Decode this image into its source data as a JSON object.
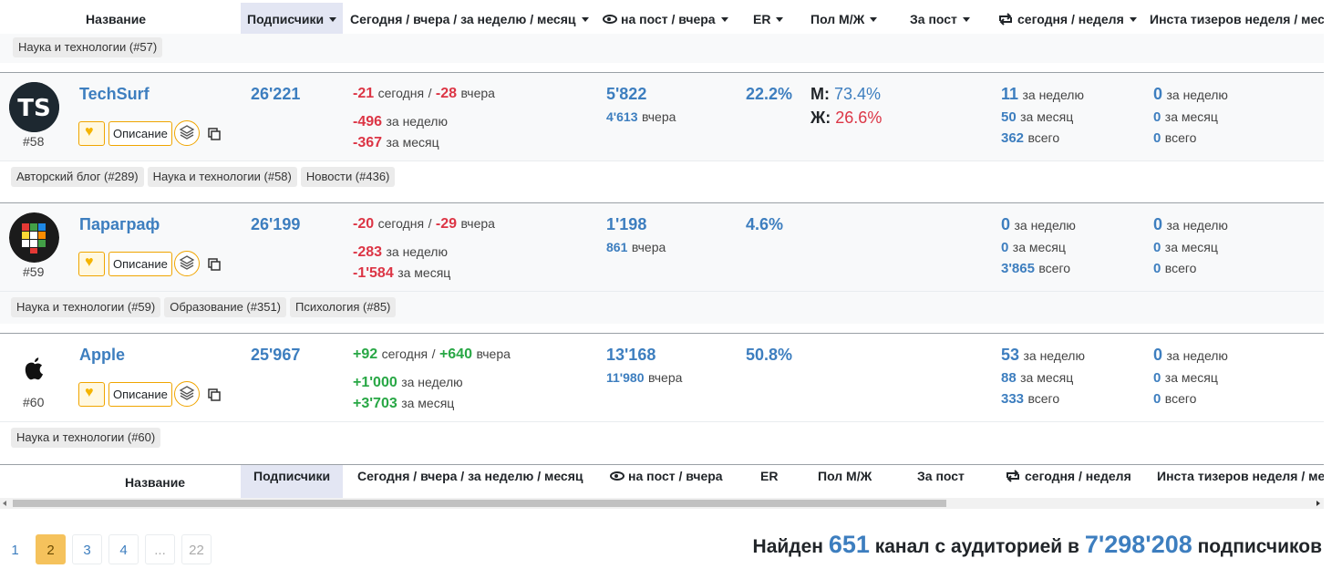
{
  "header": {
    "name": "Название",
    "subscribers": "Подписчики",
    "growth": "Сегодня / вчера / за неделю / месяц",
    "views": "на пост / вчера",
    "er": "ER",
    "gender": "Пол М/Ж",
    "per_post": "За пост",
    "reposts": "сегодня / неделя",
    "insta": "Инста тизеров неделя / месяц"
  },
  "prev_tag": "Наука и технологии (#57)",
  "labels": {
    "today": "сегодня",
    "yesterday": "вчера",
    "week": "за неделю",
    "month": "за месяц",
    "total": "всего",
    "slash": "/",
    "description": "Описание",
    "male": "М:",
    "female": "Ж:"
  },
  "rows": [
    {
      "name": "TechSurf",
      "rank": "#58",
      "subscribers": "26'221",
      "today": "-21",
      "yesterday": "-28",
      "week": "-496",
      "month": "-367",
      "views_post": "5'822",
      "views_yesterday": "4'613",
      "er": "22.2%",
      "male": "73.4%",
      "female": "26.6%",
      "rep_week": "11",
      "rep_month": "50",
      "rep_total": "362",
      "insta_week": "0",
      "insta_month": "0",
      "insta_total": "0",
      "tags": [
        "Авторский блог (#289)",
        "Наука и технологии (#58)",
        "Новости (#436)"
      ]
    },
    {
      "name": "Параграф",
      "rank": "#59",
      "subscribers": "26'199",
      "today": "-20",
      "yesterday": "-29",
      "week": "-283",
      "month": "-1'584",
      "views_post": "1'198",
      "views_yesterday": "861",
      "er": "4.6%",
      "rep_week": "0",
      "rep_month": "0",
      "rep_total": "3'865",
      "insta_week": "0",
      "insta_month": "0",
      "insta_total": "0",
      "tags": [
        "Наука и технологии (#59)",
        "Образование (#351)",
        "Психология (#85)"
      ]
    },
    {
      "name": "Apple",
      "rank": "#60",
      "subscribers": "25'967",
      "today": "+92",
      "yesterday": "+640",
      "week": "+1'000",
      "month": "+3'703",
      "views_post": "13'168",
      "views_yesterday": "11'980",
      "er": "50.8%",
      "rep_week": "53",
      "rep_month": "88",
      "rep_total": "333",
      "insta_week": "0",
      "insta_month": "0",
      "insta_total": "0",
      "tags": [
        "Наука и технологии (#60)"
      ]
    }
  ],
  "pagination": [
    "1",
    "2",
    "3",
    "4",
    "...",
    "22"
  ],
  "summary": {
    "prefix": "Найден",
    "channels": "651",
    "middle": "канал с аудиторией в",
    "audience": "7'298'208",
    "suffix": "подписчиков"
  },
  "colors": {
    "accent": "#3d7ebf",
    "negative": "#dc3545",
    "positive": "#28a745",
    "highlight": "#f5c25c"
  },
  "icons": [
    "eye-icon",
    "repost-icon",
    "heart-icon",
    "layers-icon",
    "copy-icon",
    "sort-caret-icon"
  ]
}
